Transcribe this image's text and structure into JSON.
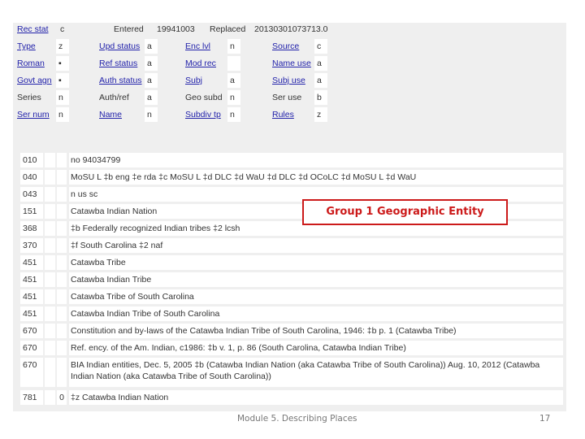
{
  "header": {
    "rec_stat_label": "Rec stat",
    "rec_stat_value": "c",
    "entered_label": "Entered",
    "entered_value": "19941003",
    "replaced_label": "Replaced",
    "replaced_value": "20130301073713.0"
  },
  "fixed_fields": [
    [
      {
        "label": "Type",
        "value": "z",
        "link": true
      },
      {
        "label": "Upd status",
        "value": "a",
        "link": true
      },
      {
        "label": "Enc lvl",
        "value": "n",
        "link": true
      },
      {
        "label": "Source",
        "value": "c",
        "link": true
      }
    ],
    [
      {
        "label": "Roman",
        "value": "▪",
        "link": true
      },
      {
        "label": "Ref status",
        "value": "a",
        "link": true
      },
      {
        "label": "Mod rec",
        "value": "",
        "link": true
      },
      {
        "label": "Name use",
        "value": "a",
        "link": true
      }
    ],
    [
      {
        "label": "Govt agn",
        "value": "▪",
        "link": true
      },
      {
        "label": "Auth status",
        "value": "a",
        "link": true
      },
      {
        "label": "Subj",
        "value": "a",
        "link": true
      },
      {
        "label": "Subj use",
        "value": "a",
        "link": true
      }
    ],
    [
      {
        "label": "Series",
        "value": "n",
        "link": false
      },
      {
        "label": "Auth/ref",
        "value": "a",
        "link": false
      },
      {
        "label": "Geo subd",
        "value": "n",
        "link": false
      },
      {
        "label": "Ser use",
        "value": "b",
        "link": false
      }
    ],
    [
      {
        "label": "Ser num",
        "value": "n",
        "link": true
      },
      {
        "label": "Name",
        "value": "n",
        "link": true
      },
      {
        "label": "Subdiv tp",
        "value": "n",
        "link": true
      },
      {
        "label": "Rules",
        "value": "z",
        "link": true
      }
    ]
  ],
  "fields": [
    {
      "tag": "010",
      "ind1": "",
      "ind2": "",
      "data": "no 94034799"
    },
    {
      "tag": "040",
      "ind1": "",
      "ind2": "",
      "data": "MoSU L ‡b eng ‡e rda ‡c MoSU L ‡d DLC ‡d WaU ‡d DLC ‡d OCoLC ‡d MoSU L ‡d WaU"
    },
    {
      "tag": "043",
      "ind1": "",
      "ind2": "",
      "data": "n us sc"
    },
    {
      "tag": "151",
      "ind1": "",
      "ind2": "",
      "data": "Catawba Indian Nation"
    },
    {
      "tag": "368",
      "ind1": "",
      "ind2": "",
      "data": "‡b Federally recognized Indian tribes ‡2 lcsh"
    },
    {
      "tag": "370",
      "ind1": "",
      "ind2": "",
      "data": "‡f South Carolina ‡2 naf"
    },
    {
      "tag": "451",
      "ind1": "",
      "ind2": "",
      "data": "Catawba Tribe"
    },
    {
      "tag": "451",
      "ind1": "",
      "ind2": "",
      "data": "Catawba Indian Tribe"
    },
    {
      "tag": "451",
      "ind1": "",
      "ind2": "",
      "data": "Catawba Tribe of South Carolina"
    },
    {
      "tag": "451",
      "ind1": "",
      "ind2": "",
      "data": "Catawba Indian Tribe of South Carolina"
    },
    {
      "tag": "670",
      "ind1": "",
      "ind2": "",
      "data": "Constitution and by-laws of the Catawba Indian Tribe of South Carolina, 1946: ‡b p. 1 (Catawba Tribe)"
    },
    {
      "tag": "670",
      "ind1": "",
      "ind2": "",
      "data": "Ref. ency. of the Am. Indian, c1986: ‡b v. 1, p. 86 (South Carolina, Catawba Indian Tribe)"
    },
    {
      "tag": "670",
      "ind1": "",
      "ind2": "",
      "data": "BIA Indian entities, Dec. 5, 2005 ‡b (Catawba Indian Nation (aka Catawba Tribe of South Carolina)) Aug. 10, 2012 (Catawba Indian Nation (aka Catawba Tribe of South Carolina))"
    },
    {
      "tag": "781",
      "ind1": "",
      "ind2": "0",
      "data": "‡z Catawba Indian Nation"
    }
  ],
  "annotation": {
    "label": "Group 1 Geographic Entity",
    "color": "#cc1a1a"
  },
  "footer": {
    "title": "Module 5. Describing Places",
    "page": "17"
  }
}
